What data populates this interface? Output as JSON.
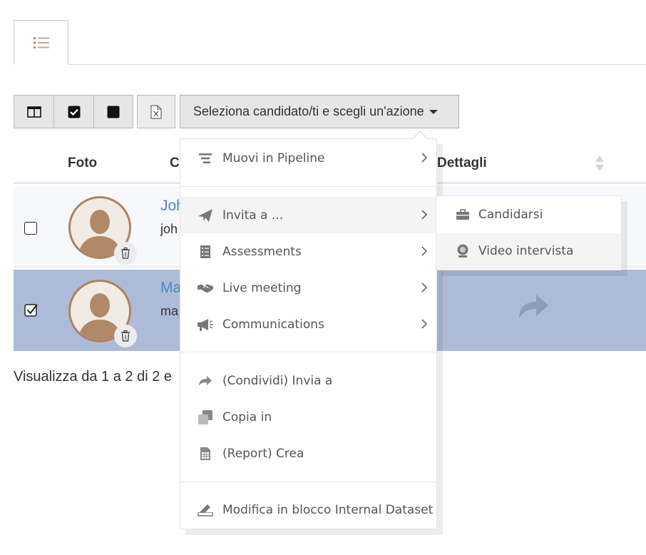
{
  "tabs": [
    {
      "icon": "list-icon"
    }
  ],
  "toolbar": {
    "buttons": [
      {
        "icon": "columns-icon"
      },
      {
        "icon": "check-square-icon"
      },
      {
        "icon": "filled-square-icon"
      },
      {
        "icon": "excel-file-icon"
      }
    ],
    "action_label": "Seleziona candidato/ti e scegli un'azione"
  },
  "table": {
    "headers": {
      "photo": "Foto",
      "candidate": "C",
      "details": "Dettagli"
    },
    "rows": [
      {
        "checked": false,
        "name": "Joh",
        "email": "joh"
      },
      {
        "checked": true,
        "name": "Ma",
        "email": "ma"
      }
    ]
  },
  "footer": {
    "info": "Visualizza da 1 a 2 di 2 e"
  },
  "menu": {
    "items": [
      {
        "label": "Muovi in Pipeline",
        "icon": "pipeline-icon",
        "submenu": true
      },
      {
        "label": "Invita a ...",
        "icon": "paper-plane-icon",
        "submenu": true
      },
      {
        "label": "Assessments",
        "icon": "checklist-icon",
        "submenu": true
      },
      {
        "label": "Live meeting",
        "icon": "handshake-icon",
        "submenu": true
      },
      {
        "label": "Communications",
        "icon": "megaphone-icon",
        "submenu": true
      },
      {
        "label": "(Condividi) Invia a",
        "icon": "share-icon",
        "submenu": false
      },
      {
        "label": "Copia in",
        "icon": "copy-icon",
        "submenu": false
      },
      {
        "label": "(Report) Crea",
        "icon": "spreadsheet-icon",
        "submenu": false
      },
      {
        "label": "Modifica in blocco Internal Dataset",
        "icon": "edit-icon",
        "submenu": false
      }
    ]
  },
  "submenu": {
    "items": [
      {
        "label": "Candidarsi",
        "icon": "briefcase-icon"
      },
      {
        "label": "Video intervista",
        "icon": "webcam-icon"
      }
    ]
  }
}
